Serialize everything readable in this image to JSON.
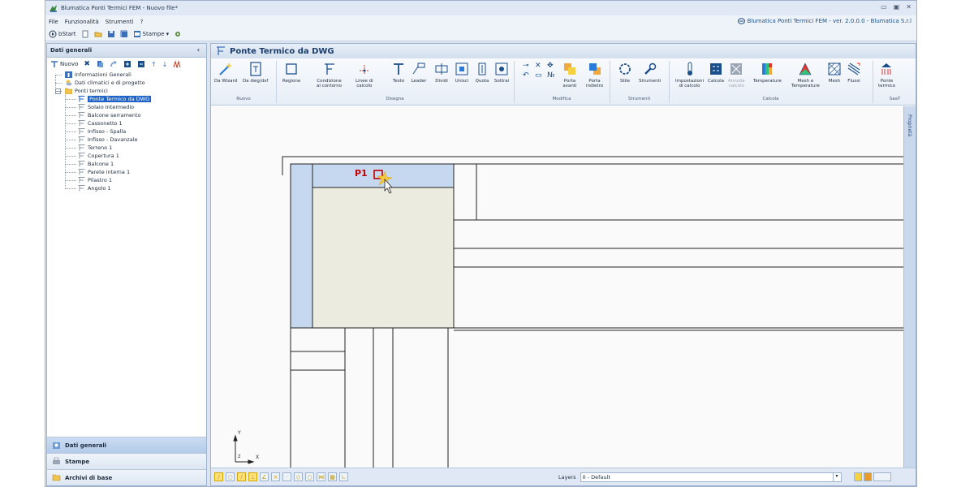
{
  "window": {
    "title": "Blumatica Ponti Termici FEM - Nuovo file*"
  },
  "menu": {
    "items": [
      "File",
      "Funzionalità",
      "Strumenti",
      "?"
    ],
    "brand": "Blumatica Ponti Termici FEM - ver. 2.0.0.0 - Blumatica S.r.l"
  },
  "quickbar": {
    "bstart": "bStart",
    "stampe": "Stampe"
  },
  "leftpanel": {
    "title": "Dati generali",
    "tool_new": "Nuovo",
    "tree": {
      "info": "Informazioni Generali",
      "climate": "Dati climatici e di progetto",
      "bridges": "Ponti termici",
      "children": [
        "Ponte Termico da DWG",
        "Solaio Intermedio",
        "Balcone serramento",
        "Cassonetto 1",
        "Infisso - Spalla",
        "Infisso - Davanzale",
        "Terreno 1",
        "Copertura 1",
        "Balcone 1",
        "Parete interna 1",
        "Pilastro 1",
        "Angolo 1"
      ],
      "selected_index": 0
    },
    "nav": [
      "Dati generali",
      "Stampe",
      "Archivi di base"
    ]
  },
  "main": {
    "title": "Ponte Termico da DWG",
    "ribbon": {
      "nuovo": [
        "Da Wizard",
        "Da dwg/dxf"
      ],
      "disegna": [
        "Regione",
        "Condizione\nal contorno",
        "Linee di\ncalcolo",
        "Testo",
        "Leader",
        "Dividi",
        "Unisci",
        "Quota",
        "Sottrai"
      ],
      "modifica": [
        "Porta\navanti",
        "Porta\nindietro"
      ],
      "strumenti": [
        "Stile",
        "Strumenti"
      ],
      "calcola": [
        "Impostazioni\ndi calcolo",
        "Calcola",
        "Annulla\ncalcolo",
        "Temperature",
        "Mesh e\nTemperature",
        "Mesh",
        "Flussi"
      ],
      "saat": [
        "Ponte\ntermico"
      ],
      "groups": [
        "Nuovo",
        "Disegna",
        "Modifica",
        "Strumenti",
        "Calcola",
        "SaaT"
      ]
    },
    "canvas": {
      "point_label": "P1",
      "axis_x": "X",
      "axis_y": "Y",
      "axis_z": "Z"
    },
    "props_tab": "Proprietà",
    "status": {
      "layers_label": "Layers",
      "layer_value": "0 - Default"
    }
  },
  "colors": {
    "accent": "#1e64c8",
    "highlight_blue": "#c5d8ef",
    "material_fill": "#ecebe0",
    "marker": "#c00000"
  }
}
